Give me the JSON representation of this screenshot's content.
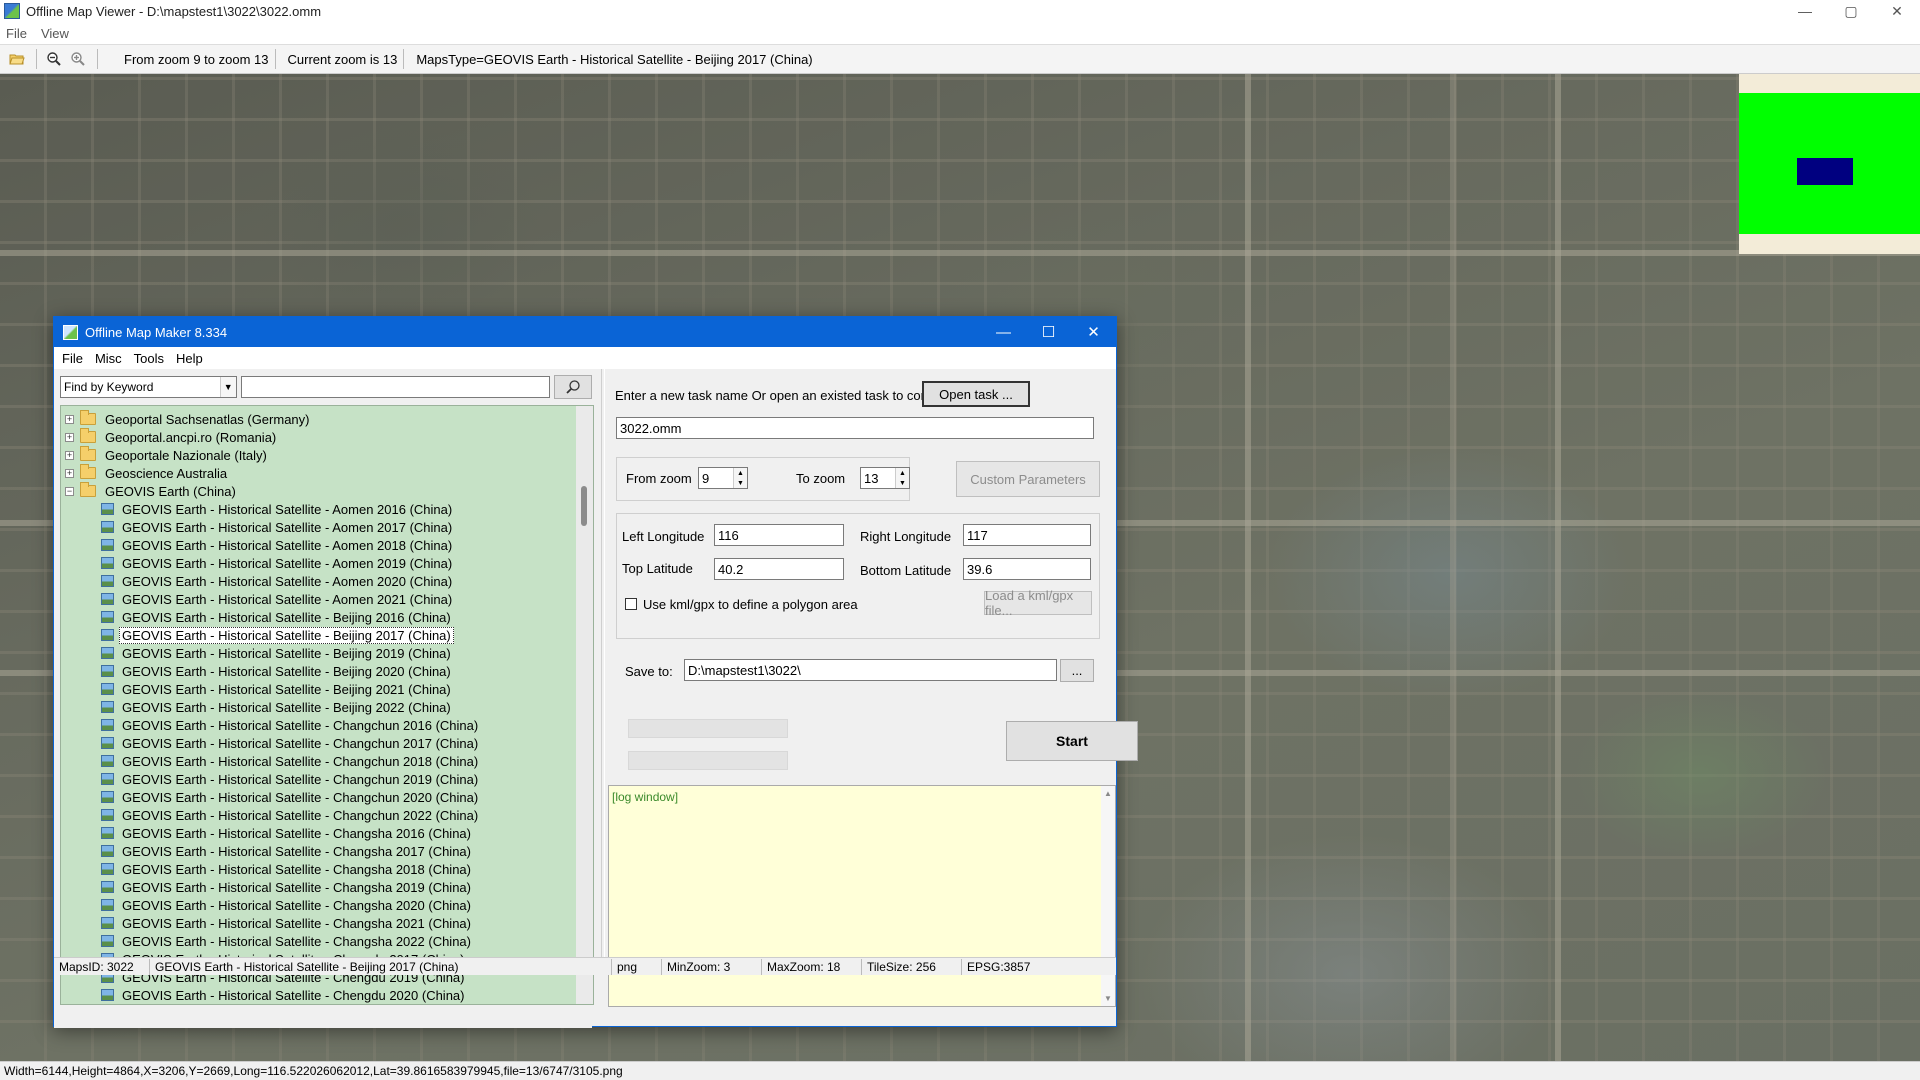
{
  "viewer": {
    "title": "Offline Map Viewer - D:\\mapstest1\\3022\\3022.omm",
    "menu": [
      "File",
      "View"
    ],
    "toolbar": {
      "zoom_range": "From zoom 9 to zoom 13",
      "current_zoom": "Current zoom is 13",
      "maps_type": "MapsType=GEOVIS Earth - Historical Satellite - Beijing 2017 (China)"
    },
    "status": "Width=6144,Height=4864,X=3206,Y=2669,Long=116.522026062012,Lat=39.8616583979945,file=13/6747/3105.png",
    "window_controls": {
      "minimize": "—",
      "maximize": "▢",
      "close": "✕"
    }
  },
  "dialog": {
    "title": "Offline Map Maker 8.334",
    "menu": [
      "File",
      "Misc",
      "Tools",
      "Help"
    ],
    "search": {
      "mode": "Find by Keyword",
      "value": ""
    },
    "tree": [
      {
        "type": "folder",
        "label": "Geoportal Sachsenatlas (Germany)",
        "expander": "+"
      },
      {
        "type": "folder",
        "label": "Geoportal.ancpi.ro (Romania)",
        "expander": "+"
      },
      {
        "type": "folder",
        "label": "Geoportale Nazionale (Italy)",
        "expander": "+"
      },
      {
        "type": "folder",
        "label": "Geoscience Australia",
        "expander": "+"
      },
      {
        "type": "folder",
        "label": "GEOVIS Earth (China)",
        "expander": "−",
        "open": true
      },
      {
        "type": "map",
        "label": "GEOVIS Earth - Historical Satellite - Aomen 2016 (China)"
      },
      {
        "type": "map",
        "label": "GEOVIS Earth - Historical Satellite - Aomen 2017 (China)"
      },
      {
        "type": "map",
        "label": "GEOVIS Earth - Historical Satellite - Aomen 2018 (China)"
      },
      {
        "type": "map",
        "label": "GEOVIS Earth - Historical Satellite - Aomen 2019 (China)"
      },
      {
        "type": "map",
        "label": "GEOVIS Earth - Historical Satellite - Aomen 2020 (China)"
      },
      {
        "type": "map",
        "label": "GEOVIS Earth - Historical Satellite - Aomen 2021 (China)"
      },
      {
        "type": "map",
        "label": "GEOVIS Earth - Historical Satellite - Beijing 2016 (China)"
      },
      {
        "type": "map",
        "label": "GEOVIS Earth - Historical Satellite - Beijing 2017 (China)",
        "selected": true
      },
      {
        "type": "map",
        "label": "GEOVIS Earth - Historical Satellite - Beijing 2019 (China)"
      },
      {
        "type": "map",
        "label": "GEOVIS Earth - Historical Satellite - Beijing 2020 (China)"
      },
      {
        "type": "map",
        "label": "GEOVIS Earth - Historical Satellite - Beijing 2021 (China)"
      },
      {
        "type": "map",
        "label": "GEOVIS Earth - Historical Satellite - Beijing 2022 (China)"
      },
      {
        "type": "map",
        "label": "GEOVIS Earth - Historical Satellite - Changchun 2016 (China)"
      },
      {
        "type": "map",
        "label": "GEOVIS Earth - Historical Satellite - Changchun 2017 (China)"
      },
      {
        "type": "map",
        "label": "GEOVIS Earth - Historical Satellite - Changchun 2018 (China)"
      },
      {
        "type": "map",
        "label": "GEOVIS Earth - Historical Satellite - Changchun 2019 (China)"
      },
      {
        "type": "map",
        "label": "GEOVIS Earth - Historical Satellite - Changchun 2020 (China)"
      },
      {
        "type": "map",
        "label": "GEOVIS Earth - Historical Satellite - Changchun 2022 (China)"
      },
      {
        "type": "map",
        "label": "GEOVIS Earth - Historical Satellite - Changsha 2016 (China)"
      },
      {
        "type": "map",
        "label": "GEOVIS Earth - Historical Satellite - Changsha 2017 (China)"
      },
      {
        "type": "map",
        "label": "GEOVIS Earth - Historical Satellite - Changsha 2018 (China)"
      },
      {
        "type": "map",
        "label": "GEOVIS Earth - Historical Satellite - Changsha 2019 (China)"
      },
      {
        "type": "map",
        "label": "GEOVIS Earth - Historical Satellite - Changsha 2020 (China)"
      },
      {
        "type": "map",
        "label": "GEOVIS Earth - Historical Satellite - Changsha 2021 (China)"
      },
      {
        "type": "map",
        "label": "GEOVIS Earth - Historical Satellite - Changsha 2022 (China)"
      },
      {
        "type": "map",
        "label": "GEOVIS Earth - Historical Satellite - Chengdu 2017 (China)"
      },
      {
        "type": "map",
        "label": "GEOVIS Earth - Historical Satellite - Chengdu 2019 (China)"
      },
      {
        "type": "map",
        "label": "GEOVIS Earth - Historical Satellite - Chengdu 2020 (China)"
      }
    ],
    "status": {
      "maps_id": "MapsID: 3022",
      "map_name": "GEOVIS Earth - Historical Satellite - Beijing 2017 (China)",
      "format": "png",
      "min_zoom": "MinZoom: 3",
      "max_zoom": "MaxZoom: 18",
      "tile_size": "TileSize: 256",
      "epsg": "EPSG:3857"
    },
    "task": {
      "prompt": "Enter a new task name Or open an existed task to continue:",
      "open_task_label": "Open task ...",
      "task_name": "3022.omm"
    },
    "zoom": {
      "from_label": "From zoom",
      "from_value": "9",
      "to_label": "To zoom",
      "to_value": "13",
      "custom_params_label": "Custom Parameters"
    },
    "area": {
      "left_lon_label": "Left Longitude",
      "left_lon_value": "116",
      "right_lon_label": "Right Longitude",
      "right_lon_value": "117",
      "top_lat_label": "Top Latitude",
      "top_lat_value": "40.2",
      "bottom_lat_label": "Bottom Latitude",
      "bottom_lat_value": "39.6",
      "kml_checkbox_label": "Use kml/gpx to define a polygon area",
      "kml_checked": false,
      "load_kml_label": "Load a kml/gpx file..."
    },
    "save": {
      "label": "Save to:",
      "path": "D:\\mapstest1\\3022\\",
      "browse_label": "..."
    },
    "start_label": "Start",
    "log_label": "[log window]"
  },
  "colors": {
    "dialog_title_bg": "#0a64d6",
    "tree_bg": "#c6e2c6",
    "log_bg": "#ffffd8",
    "overview_green": "#00ff00",
    "overview_rect": "#000080"
  }
}
